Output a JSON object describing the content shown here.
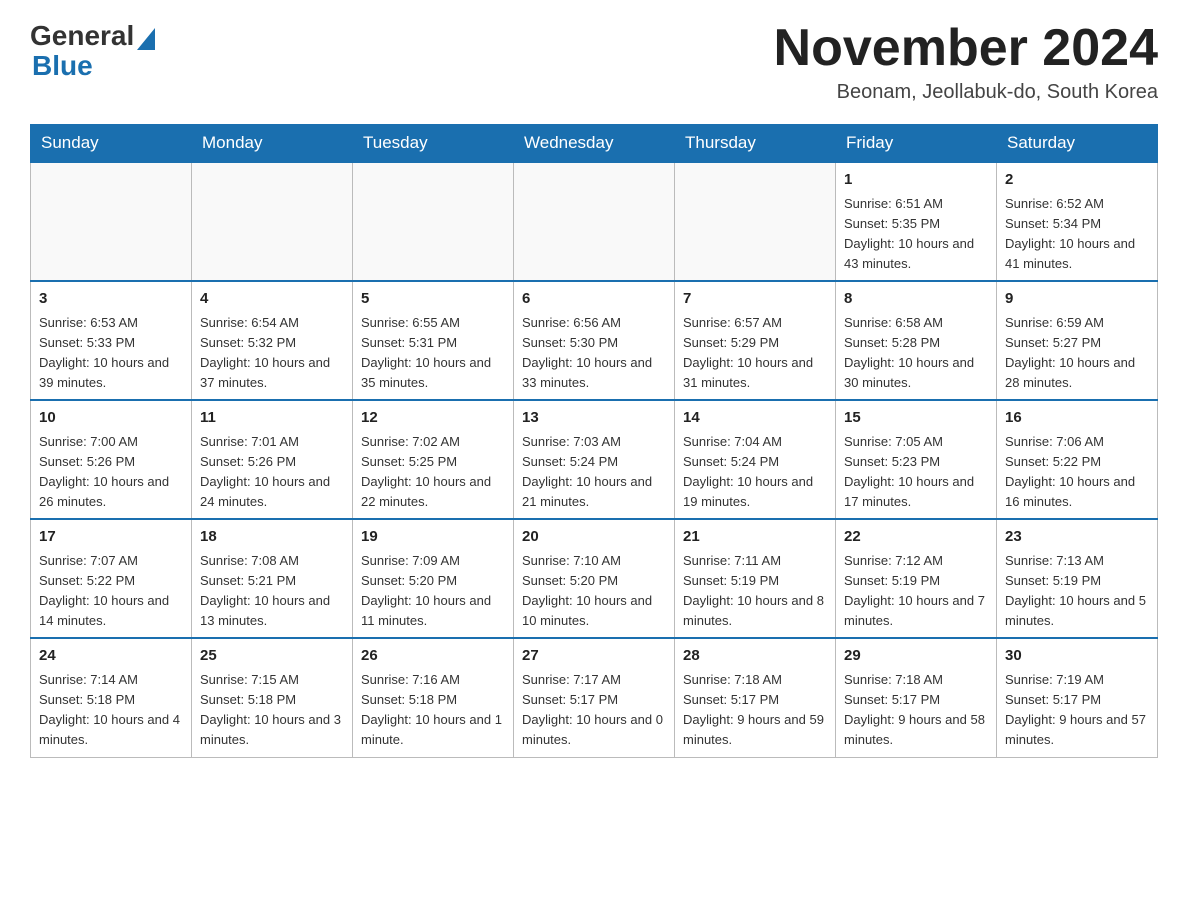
{
  "header": {
    "title": "November 2024",
    "subtitle": "Beonam, Jeollabuk-do, South Korea",
    "logo_general": "General",
    "logo_blue": "Blue"
  },
  "days_of_week": [
    "Sunday",
    "Monday",
    "Tuesday",
    "Wednesday",
    "Thursday",
    "Friday",
    "Saturday"
  ],
  "weeks": [
    {
      "days": [
        {
          "num": "",
          "info": ""
        },
        {
          "num": "",
          "info": ""
        },
        {
          "num": "",
          "info": ""
        },
        {
          "num": "",
          "info": ""
        },
        {
          "num": "",
          "info": ""
        },
        {
          "num": "1",
          "info": "Sunrise: 6:51 AM\nSunset: 5:35 PM\nDaylight: 10 hours and 43 minutes."
        },
        {
          "num": "2",
          "info": "Sunrise: 6:52 AM\nSunset: 5:34 PM\nDaylight: 10 hours and 41 minutes."
        }
      ]
    },
    {
      "days": [
        {
          "num": "3",
          "info": "Sunrise: 6:53 AM\nSunset: 5:33 PM\nDaylight: 10 hours and 39 minutes."
        },
        {
          "num": "4",
          "info": "Sunrise: 6:54 AM\nSunset: 5:32 PM\nDaylight: 10 hours and 37 minutes."
        },
        {
          "num": "5",
          "info": "Sunrise: 6:55 AM\nSunset: 5:31 PM\nDaylight: 10 hours and 35 minutes."
        },
        {
          "num": "6",
          "info": "Sunrise: 6:56 AM\nSunset: 5:30 PM\nDaylight: 10 hours and 33 minutes."
        },
        {
          "num": "7",
          "info": "Sunrise: 6:57 AM\nSunset: 5:29 PM\nDaylight: 10 hours and 31 minutes."
        },
        {
          "num": "8",
          "info": "Sunrise: 6:58 AM\nSunset: 5:28 PM\nDaylight: 10 hours and 30 minutes."
        },
        {
          "num": "9",
          "info": "Sunrise: 6:59 AM\nSunset: 5:27 PM\nDaylight: 10 hours and 28 minutes."
        }
      ]
    },
    {
      "days": [
        {
          "num": "10",
          "info": "Sunrise: 7:00 AM\nSunset: 5:26 PM\nDaylight: 10 hours and 26 minutes."
        },
        {
          "num": "11",
          "info": "Sunrise: 7:01 AM\nSunset: 5:26 PM\nDaylight: 10 hours and 24 minutes."
        },
        {
          "num": "12",
          "info": "Sunrise: 7:02 AM\nSunset: 5:25 PM\nDaylight: 10 hours and 22 minutes."
        },
        {
          "num": "13",
          "info": "Sunrise: 7:03 AM\nSunset: 5:24 PM\nDaylight: 10 hours and 21 minutes."
        },
        {
          "num": "14",
          "info": "Sunrise: 7:04 AM\nSunset: 5:24 PM\nDaylight: 10 hours and 19 minutes."
        },
        {
          "num": "15",
          "info": "Sunrise: 7:05 AM\nSunset: 5:23 PM\nDaylight: 10 hours and 17 minutes."
        },
        {
          "num": "16",
          "info": "Sunrise: 7:06 AM\nSunset: 5:22 PM\nDaylight: 10 hours and 16 minutes."
        }
      ]
    },
    {
      "days": [
        {
          "num": "17",
          "info": "Sunrise: 7:07 AM\nSunset: 5:22 PM\nDaylight: 10 hours and 14 minutes."
        },
        {
          "num": "18",
          "info": "Sunrise: 7:08 AM\nSunset: 5:21 PM\nDaylight: 10 hours and 13 minutes."
        },
        {
          "num": "19",
          "info": "Sunrise: 7:09 AM\nSunset: 5:20 PM\nDaylight: 10 hours and 11 minutes."
        },
        {
          "num": "20",
          "info": "Sunrise: 7:10 AM\nSunset: 5:20 PM\nDaylight: 10 hours and 10 minutes."
        },
        {
          "num": "21",
          "info": "Sunrise: 7:11 AM\nSunset: 5:19 PM\nDaylight: 10 hours and 8 minutes."
        },
        {
          "num": "22",
          "info": "Sunrise: 7:12 AM\nSunset: 5:19 PM\nDaylight: 10 hours and 7 minutes."
        },
        {
          "num": "23",
          "info": "Sunrise: 7:13 AM\nSunset: 5:19 PM\nDaylight: 10 hours and 5 minutes."
        }
      ]
    },
    {
      "days": [
        {
          "num": "24",
          "info": "Sunrise: 7:14 AM\nSunset: 5:18 PM\nDaylight: 10 hours and 4 minutes."
        },
        {
          "num": "25",
          "info": "Sunrise: 7:15 AM\nSunset: 5:18 PM\nDaylight: 10 hours and 3 minutes."
        },
        {
          "num": "26",
          "info": "Sunrise: 7:16 AM\nSunset: 5:18 PM\nDaylight: 10 hours and 1 minute."
        },
        {
          "num": "27",
          "info": "Sunrise: 7:17 AM\nSunset: 5:17 PM\nDaylight: 10 hours and 0 minutes."
        },
        {
          "num": "28",
          "info": "Sunrise: 7:18 AM\nSunset: 5:17 PM\nDaylight: 9 hours and 59 minutes."
        },
        {
          "num": "29",
          "info": "Sunrise: 7:18 AM\nSunset: 5:17 PM\nDaylight: 9 hours and 58 minutes."
        },
        {
          "num": "30",
          "info": "Sunrise: 7:19 AM\nSunset: 5:17 PM\nDaylight: 9 hours and 57 minutes."
        }
      ]
    }
  ]
}
